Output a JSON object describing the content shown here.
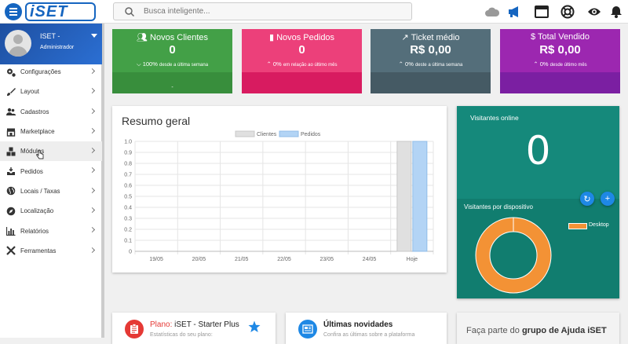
{
  "topbar": {
    "logo_text": "iSET",
    "search_placeholder": "Busca inteligente...",
    "icons": [
      "cloud-icon",
      "megaphone-icon",
      "window-icon",
      "lifebuoy-icon",
      "eye-icon",
      "bell-icon"
    ]
  },
  "user": {
    "name": "ISET -",
    "role": "Administrador"
  },
  "sidebar": {
    "items": [
      {
        "label": "Configurações",
        "icon": "gears-icon"
      },
      {
        "label": "Layout",
        "icon": "brush-icon"
      },
      {
        "label": "Cadastros",
        "icon": "users-icon"
      },
      {
        "label": "Marketplace",
        "icon": "store-icon"
      },
      {
        "label": "Módulos",
        "icon": "cubes-icon"
      },
      {
        "label": "Pedidos",
        "icon": "inbox-download-icon"
      },
      {
        "label": "Locais / Taxas",
        "icon": "globe-icon"
      },
      {
        "label": "Localização",
        "icon": "compass-icon"
      },
      {
        "label": "Relatórios",
        "icon": "bar-chart-icon"
      },
      {
        "label": "Ferramentas",
        "icon": "tools-icon"
      }
    ]
  },
  "stats": [
    {
      "title": "Novos Clientes",
      "value": "0",
      "sub": "100%",
      "sub_small": "desde a última semana",
      "icon": "users-icon",
      "color": "#43a047",
      "footer": "#388e3c",
      "footer_text": "-"
    },
    {
      "title": "Novos Pedidos",
      "value": "0",
      "sub": "0%",
      "sub_small": "em relação ao último mês",
      "icon": "file-icon",
      "color": "#ec407a",
      "footer": "#d81b60",
      "footer_text": ""
    },
    {
      "title": "Ticket médio",
      "value": "R$ 0,00",
      "sub": "0%",
      "sub_small": "deste a última semana",
      "icon": "trend-up-icon",
      "color": "#546e7a",
      "footer": "#455a64",
      "footer_text": ""
    },
    {
      "title": "Total Vendido",
      "value": "R$ 0,00",
      "sub": "0%",
      "sub_small": "desde último mês",
      "icon": "dollar-icon",
      "color": "#9c27b0",
      "footer": "#7b1fa2",
      "footer_text": ""
    }
  ],
  "overview": {
    "title": "Resumo geral",
    "chart_data": {
      "type": "bar",
      "categories": [
        "19/05",
        "20/05",
        "21/05",
        "22/05",
        "23/05",
        "24/05",
        "Hoje"
      ],
      "series": [
        {
          "name": "Clientes",
          "values": [
            0,
            0,
            0,
            0,
            0,
            0,
            1.0
          ],
          "color": "#e0e0e0"
        },
        {
          "name": "Pedidos",
          "values": [
            0,
            0,
            0,
            0,
            0,
            0,
            1.0
          ],
          "color": "#b3d4f5"
        }
      ],
      "ylim": [
        0,
        1.0
      ],
      "yticks": [
        "0",
        "0.1",
        "0.2",
        "0.3",
        "0.4",
        "0.5",
        "0.6",
        "0.7",
        "0.8",
        "0.9",
        "1.0"
      ],
      "grid": true,
      "legend": "top-center"
    }
  },
  "visitors": {
    "online_title": "Visitantes online",
    "online_value": "0",
    "refresh_icon": "refresh-icon",
    "add_icon": "plus-icon",
    "device_title": "Visitantes por dispositivo",
    "device_chart": {
      "type": "pie",
      "labels": [
        "Desktop"
      ],
      "values": [
        100
      ],
      "colors": [
        "#f39235"
      ]
    }
  },
  "bottom": {
    "plan_label": "Plano:",
    "plan_name": "iSET - Starter Plus",
    "plan_sub": "Estatísticas do seu plano:",
    "news_title": "Últimas novidades",
    "news_sub": "Confira as últimas sobre a plataforma",
    "group_text": "Faça parte do",
    "group_bold": "grupo de Ajuda iSET"
  }
}
